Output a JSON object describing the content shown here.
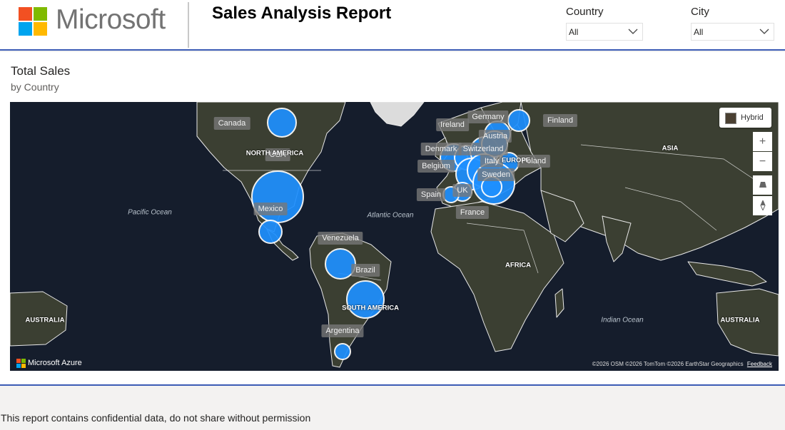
{
  "header": {
    "brand": "Microsoft",
    "brand_colors": [
      "#f25022",
      "#7fba00",
      "#00a4ef",
      "#ffb900"
    ],
    "title": "Sales Analysis Report"
  },
  "filters": {
    "country": {
      "label": "Country",
      "selected": "All"
    },
    "city": {
      "label": "City",
      "selected": "All"
    }
  },
  "visual": {
    "title": "Total Sales",
    "subtitle": "by Country",
    "map_style_button": "Hybrid",
    "controls": [
      "zoom-in-icon",
      "zoom-out-icon",
      "tilt-icon",
      "compass-icon"
    ],
    "bubble_color": "#1e90ff",
    "country_labels": [
      "Canada",
      "USA",
      "Mexico",
      "Venezuela",
      "Brazil",
      "Argentina",
      "Ireland",
      "Germany",
      "Finland",
      "Austria",
      "Denmark",
      "Switzerland",
      "Belgium",
      "Italy",
      "Poland",
      "Sweden",
      "Spain",
      "UK",
      "France"
    ],
    "region_labels": [
      "NORTH AMERICA",
      "SOUTH AMERICA",
      "EUROPE",
      "AFRICA",
      "ASIA",
      "AUSTRALIA"
    ],
    "ocean_labels": [
      "Pacific Ocean",
      "Atlantic Ocean",
      "Indian Ocean"
    ],
    "azure_logo_text": "Microsoft Azure",
    "attribution": "©2026 OSM  ©2026 TomTom  ©2026 EarthStar Geographics",
    "feedback": "Feedback"
  },
  "footer": {
    "notice": "This report contains confidential data, do not share without permission"
  }
}
